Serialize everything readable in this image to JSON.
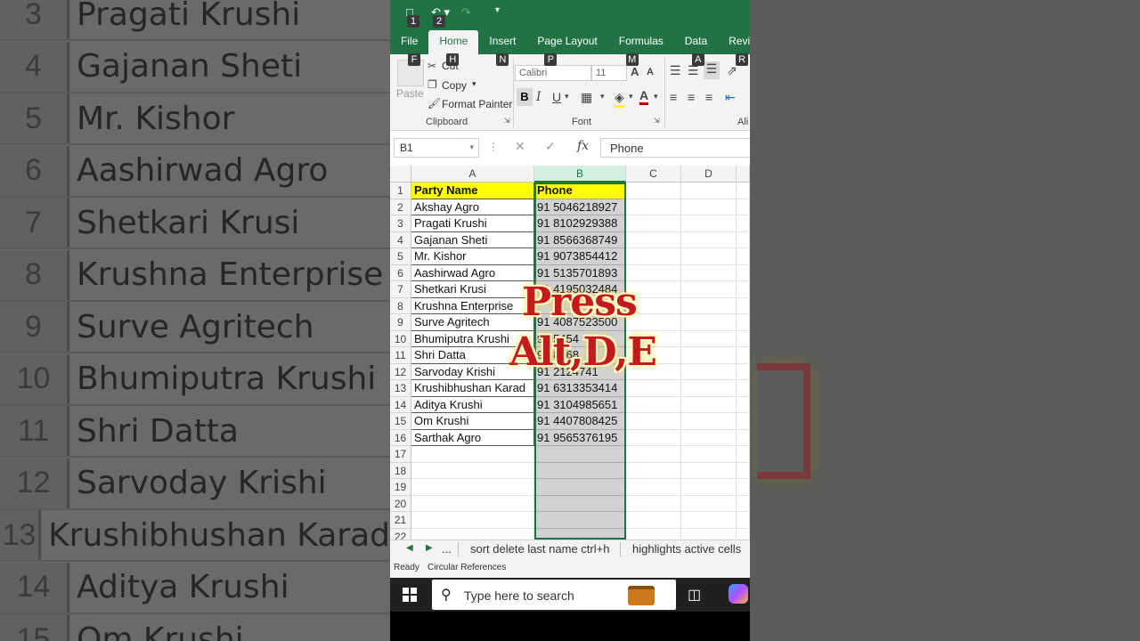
{
  "background": {
    "rows": [
      {
        "num": "3",
        "name": "Pragati Krushi"
      },
      {
        "num": "4",
        "name": "Gajanan Sheti"
      },
      {
        "num": "5",
        "name": "Mr. Kishor"
      },
      {
        "num": "6",
        "name": "Aashirwad Agro"
      },
      {
        "num": "7",
        "name": "Shetkari Krusi"
      },
      {
        "num": "8",
        "name": "Krushna Enterprise"
      },
      {
        "num": "9",
        "name": "Surve Agritech"
      },
      {
        "num": "10",
        "name": "Bhumiputra Krushi"
      },
      {
        "num": "11",
        "name": "Shri Datta"
      },
      {
        "num": "12",
        "name": "Sarvoday Krishi"
      },
      {
        "num": "13",
        "name": "Krushibhushan Karad"
      },
      {
        "num": "14",
        "name": "Aditya Krushi"
      },
      {
        "num": "15",
        "name": "Om Krushi"
      }
    ]
  },
  "quick_access": {
    "keytip1": "1",
    "keytip2": "2"
  },
  "tabs": [
    {
      "label": "File",
      "keytip": "F"
    },
    {
      "label": "Home",
      "keytip": "H"
    },
    {
      "label": "Insert",
      "keytip": "N"
    },
    {
      "label": "Page Layout",
      "keytip": "P"
    },
    {
      "label": "Formulas",
      "keytip": "M"
    },
    {
      "label": "Data",
      "keytip": "A"
    },
    {
      "label": "Revi",
      "keytip": "R"
    }
  ],
  "ribbon": {
    "paste": "Paste",
    "cut": "Cut",
    "copy": "Copy",
    "format_painter": "Format Painter",
    "clipboard_group": "Clipboard",
    "font_name": "Calibri",
    "font_size": "11",
    "font_group": "Font",
    "align_group": "Ali",
    "bold": "B",
    "italic": "I",
    "underline": "U"
  },
  "formula_bar": {
    "name_box": "B1",
    "fx": "fx",
    "value": "Phone"
  },
  "columns": [
    "A",
    "B",
    "C",
    "D"
  ],
  "rows": [
    {
      "num": "1",
      "a": "Party Name",
      "b": "Phone"
    },
    {
      "num": "2",
      "a": "Akshay Agro",
      "b": "91 5046218927"
    },
    {
      "num": "3",
      "a": "Pragati Krushi",
      "b": "91 8102929388"
    },
    {
      "num": "4",
      "a": "Gajanan Sheti",
      "b": "91 8566368749"
    },
    {
      "num": "5",
      "a": "Mr. Kishor",
      "b": "91 9073854412"
    },
    {
      "num": "6",
      "a": "Aashirwad Agro",
      "b": "91 5135701893"
    },
    {
      "num": "7",
      "a": "Shetkari Krusi",
      "b": "91 4195032484"
    },
    {
      "num": "8",
      "a": "Krushna Enterprise",
      "b": ""
    },
    {
      "num": "9",
      "a": "Surve Agritech",
      "b": "91 4087523500"
    },
    {
      "num": "10",
      "a": "Bhumiputra Krushi",
      "b": "91 5454"
    },
    {
      "num": "11",
      "a": "Shri Datta",
      "b": "91 8068"
    },
    {
      "num": "12",
      "a": "Sarvoday Krishi",
      "b": "91 2124741"
    },
    {
      "num": "13",
      "a": "Krushibhushan Karad",
      "b": "91 6313353414"
    },
    {
      "num": "14",
      "a": "Aditya Krushi",
      "b": "91 3104985651"
    },
    {
      "num": "15",
      "a": "Om Krushi",
      "b": "91 4407808425"
    },
    {
      "num": "16",
      "a": "Sarthak Agro",
      "b": "91 9565376195"
    },
    {
      "num": "17",
      "a": "",
      "b": ""
    },
    {
      "num": "18",
      "a": "",
      "b": ""
    },
    {
      "num": "19",
      "a": "",
      "b": ""
    },
    {
      "num": "20",
      "a": "",
      "b": ""
    },
    {
      "num": "21",
      "a": "",
      "b": ""
    },
    {
      "num": "22",
      "a": "",
      "b": ""
    }
  ],
  "sheet_tabs": {
    "ellipsis": "...",
    "tab1": "sort delete last name ctrl+h",
    "tab2": "highlights active cells"
  },
  "status": {
    "ready": "Ready",
    "circular": "Circular References"
  },
  "taskbar": {
    "search_placeholder": "Type here to search"
  },
  "overlay": {
    "line1": "Press",
    "line2": "Alt,D,E"
  },
  "colors": {
    "excel_green": "#217346",
    "header_fill": "#ffff00",
    "overlay_text": "#c41a1a"
  }
}
